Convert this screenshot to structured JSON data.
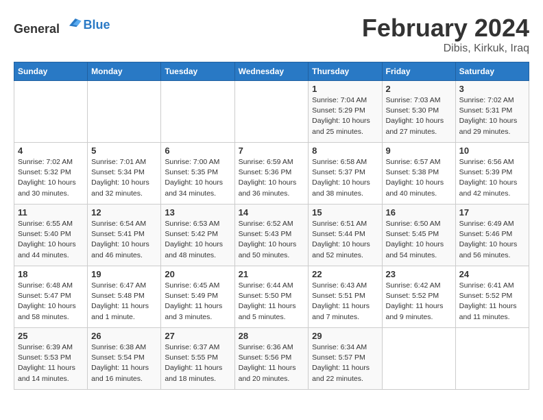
{
  "logo": {
    "text_general": "General",
    "text_blue": "Blue"
  },
  "header": {
    "title": "February 2024",
    "subtitle": "Dibis, Kirkuk, Iraq"
  },
  "days_of_week": [
    "Sunday",
    "Monday",
    "Tuesday",
    "Wednesday",
    "Thursday",
    "Friday",
    "Saturday"
  ],
  "weeks": [
    [
      {
        "day": "",
        "info": ""
      },
      {
        "day": "",
        "info": ""
      },
      {
        "day": "",
        "info": ""
      },
      {
        "day": "",
        "info": ""
      },
      {
        "day": "1",
        "info": "Sunrise: 7:04 AM\nSunset: 5:29 PM\nDaylight: 10 hours\nand 25 minutes."
      },
      {
        "day": "2",
        "info": "Sunrise: 7:03 AM\nSunset: 5:30 PM\nDaylight: 10 hours\nand 27 minutes."
      },
      {
        "day": "3",
        "info": "Sunrise: 7:02 AM\nSunset: 5:31 PM\nDaylight: 10 hours\nand 29 minutes."
      }
    ],
    [
      {
        "day": "4",
        "info": "Sunrise: 7:02 AM\nSunset: 5:32 PM\nDaylight: 10 hours\nand 30 minutes."
      },
      {
        "day": "5",
        "info": "Sunrise: 7:01 AM\nSunset: 5:34 PM\nDaylight: 10 hours\nand 32 minutes."
      },
      {
        "day": "6",
        "info": "Sunrise: 7:00 AM\nSunset: 5:35 PM\nDaylight: 10 hours\nand 34 minutes."
      },
      {
        "day": "7",
        "info": "Sunrise: 6:59 AM\nSunset: 5:36 PM\nDaylight: 10 hours\nand 36 minutes."
      },
      {
        "day": "8",
        "info": "Sunrise: 6:58 AM\nSunset: 5:37 PM\nDaylight: 10 hours\nand 38 minutes."
      },
      {
        "day": "9",
        "info": "Sunrise: 6:57 AM\nSunset: 5:38 PM\nDaylight: 10 hours\nand 40 minutes."
      },
      {
        "day": "10",
        "info": "Sunrise: 6:56 AM\nSunset: 5:39 PM\nDaylight: 10 hours\nand 42 minutes."
      }
    ],
    [
      {
        "day": "11",
        "info": "Sunrise: 6:55 AM\nSunset: 5:40 PM\nDaylight: 10 hours\nand 44 minutes."
      },
      {
        "day": "12",
        "info": "Sunrise: 6:54 AM\nSunset: 5:41 PM\nDaylight: 10 hours\nand 46 minutes."
      },
      {
        "day": "13",
        "info": "Sunrise: 6:53 AM\nSunset: 5:42 PM\nDaylight: 10 hours\nand 48 minutes."
      },
      {
        "day": "14",
        "info": "Sunrise: 6:52 AM\nSunset: 5:43 PM\nDaylight: 10 hours\nand 50 minutes."
      },
      {
        "day": "15",
        "info": "Sunrise: 6:51 AM\nSunset: 5:44 PM\nDaylight: 10 hours\nand 52 minutes."
      },
      {
        "day": "16",
        "info": "Sunrise: 6:50 AM\nSunset: 5:45 PM\nDaylight: 10 hours\nand 54 minutes."
      },
      {
        "day": "17",
        "info": "Sunrise: 6:49 AM\nSunset: 5:46 PM\nDaylight: 10 hours\nand 56 minutes."
      }
    ],
    [
      {
        "day": "18",
        "info": "Sunrise: 6:48 AM\nSunset: 5:47 PM\nDaylight: 10 hours\nand 58 minutes."
      },
      {
        "day": "19",
        "info": "Sunrise: 6:47 AM\nSunset: 5:48 PM\nDaylight: 11 hours\nand 1 minute."
      },
      {
        "day": "20",
        "info": "Sunrise: 6:45 AM\nSunset: 5:49 PM\nDaylight: 11 hours\nand 3 minutes."
      },
      {
        "day": "21",
        "info": "Sunrise: 6:44 AM\nSunset: 5:50 PM\nDaylight: 11 hours\nand 5 minutes."
      },
      {
        "day": "22",
        "info": "Sunrise: 6:43 AM\nSunset: 5:51 PM\nDaylight: 11 hours\nand 7 minutes."
      },
      {
        "day": "23",
        "info": "Sunrise: 6:42 AM\nSunset: 5:52 PM\nDaylight: 11 hours\nand 9 minutes."
      },
      {
        "day": "24",
        "info": "Sunrise: 6:41 AM\nSunset: 5:52 PM\nDaylight: 11 hours\nand 11 minutes."
      }
    ],
    [
      {
        "day": "25",
        "info": "Sunrise: 6:39 AM\nSunset: 5:53 PM\nDaylight: 11 hours\nand 14 minutes."
      },
      {
        "day": "26",
        "info": "Sunrise: 6:38 AM\nSunset: 5:54 PM\nDaylight: 11 hours\nand 16 minutes."
      },
      {
        "day": "27",
        "info": "Sunrise: 6:37 AM\nSunset: 5:55 PM\nDaylight: 11 hours\nand 18 minutes."
      },
      {
        "day": "28",
        "info": "Sunrise: 6:36 AM\nSunset: 5:56 PM\nDaylight: 11 hours\nand 20 minutes."
      },
      {
        "day": "29",
        "info": "Sunrise: 6:34 AM\nSunset: 5:57 PM\nDaylight: 11 hours\nand 22 minutes."
      },
      {
        "day": "",
        "info": ""
      },
      {
        "day": "",
        "info": ""
      }
    ]
  ]
}
